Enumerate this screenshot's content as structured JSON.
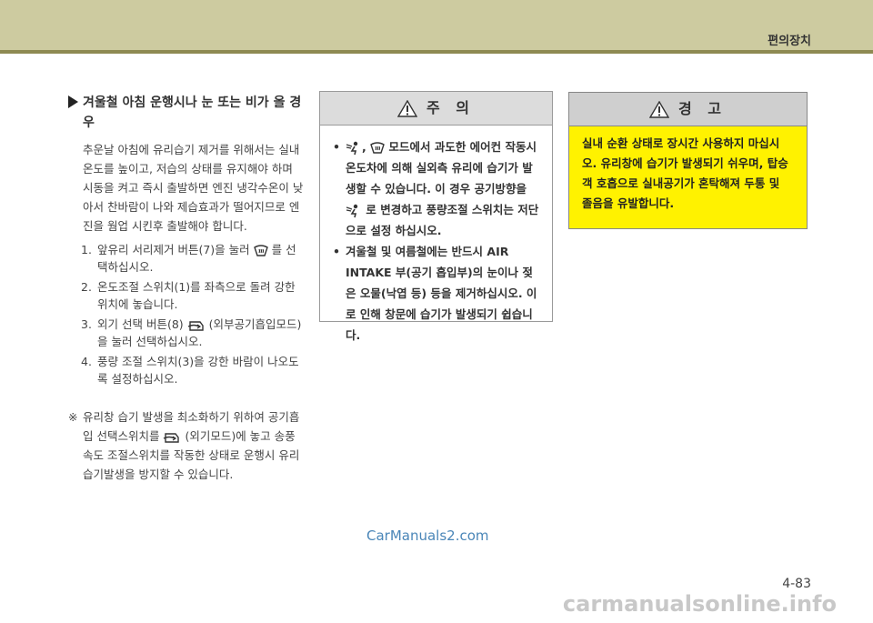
{
  "header": {
    "section_title": "편의장치"
  },
  "left": {
    "heading": "겨울철 아침 운행시나 눈 또는 비가 올 경우",
    "intro": "추운날 아침에 유리습기 제거를 위해서는 실내온도를 높이고, 저습의 상태를 유지해야 하며 시동을 켜고 즉시 출발하면 엔진 냉각수온이 낮아서 찬바람이 나와 제습효과가 떨어지므로 엔진을 웜업 시킨후 출발해야 합니다.",
    "steps": [
      {
        "num": "1.",
        "before": "앞유리 서리제거 버튼(7)을 눌러",
        "after": "를 선택하십시오.",
        "icon": "defrost-icon"
      },
      {
        "num": "2.",
        "before": "온도조절 스위치(1)를 좌측으로 돌려 강한 위치에 놓습니다.",
        "after": "",
        "icon": ""
      },
      {
        "num": "3.",
        "before": "외기 선택 버튼(8)",
        "after": "(외부공기흡입모드)을 눌러 선택하십시오.",
        "icon": "fresh-air-icon"
      },
      {
        "num": "4.",
        "before": "풍량 조절 스위치(3)을 강한 바람이 나오도록 설정하십시오.",
        "after": "",
        "icon": ""
      }
    ],
    "note_mark": "※",
    "note_before": "유리창 습기 발생을 최소화하기 위하여 공기흡입 선택스위치를",
    "note_after": "(외기모드)에 놓고 송풍속도 조절스위치를 작동한 상태로 운행시 유리 습기발생을 방지할 수 있습니다."
  },
  "caution": {
    "title": "주 의",
    "bullet1_sep": ",",
    "bullet1_a": "모드에서 과도한 에어컨 작동시 온도차에 의해 실외측 유리에 습기가 발생할 수 있습니다. 이 경우 공기방향을",
    "bullet1_b": "로 변경하고 풍량조절 스위치는 저단으로 설정 하십시오.",
    "bullet2": "겨울철 및 여름철에는 반드시 AIR INTAKE 부(공기 흡입부)의 눈이나 젖은 오물(낙엽 등) 등을 제거하십시오. 이로 인해 창문에 습기가 발생되기 쉽습니다."
  },
  "warning": {
    "title": "경 고",
    "body": "실내 순환 상태로 장시간 사용하지 마십시오. 유리창에 습기가 발생되기 쉬우며, 탑승객 호흡으로 실내공기가 혼탁해져 두통 및 졸음을 유발합니다."
  },
  "watermark": "CarManuals2.com",
  "page_number": "4-83",
  "footer_watermark": "carmanualsonline.info",
  "colors": {
    "header": "#cdcba0",
    "header_line": "#8e8a52",
    "warning_bg": "#fff200"
  }
}
